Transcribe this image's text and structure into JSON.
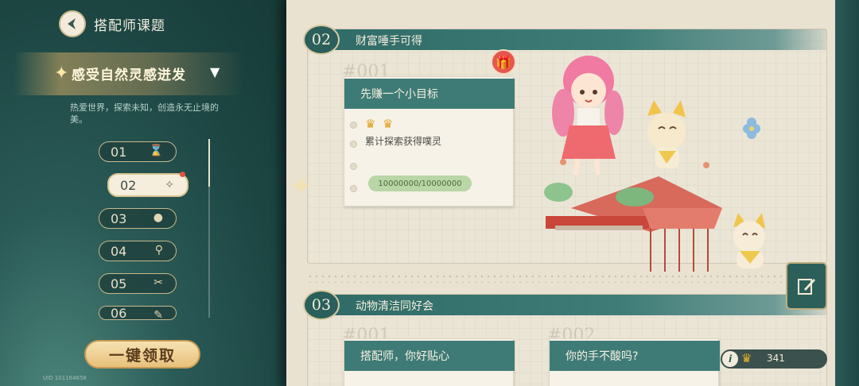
{
  "header": {
    "title": "搭配师课题"
  },
  "theme": {
    "title": "感受自然灵感迸发",
    "description": "热爱世界，探索未知，创造永无止境的美。"
  },
  "chapters": [
    {
      "label": "01",
      "icon": "hourglass-icon"
    },
    {
      "label": "02",
      "icon": "sparkle-icon"
    },
    {
      "label": "03",
      "icon": "macaron-icon"
    },
    {
      "label": "04",
      "icon": "magnifier-icon"
    },
    {
      "label": "05",
      "icon": "sewing-icon"
    },
    {
      "label": "06",
      "icon": "brush-icon"
    }
  ],
  "claim_button": "一键领取",
  "uid": "UID 101164658",
  "cards": [
    {
      "number": "02",
      "title": "财富唾手可得",
      "ghost": "#001",
      "task_title": "先赚一个小目标",
      "task_text": "累计探索获得噗灵",
      "progress": "10000000/10000000",
      "crowns": 2
    },
    {
      "number": "03",
      "title": "动物清洁同好会",
      "ghost1": "#001",
      "ghost2": "#002",
      "task1_title": "搭配师，你好贴心",
      "task2_title": "你的手不酸吗?"
    }
  ],
  "score": {
    "value": "341"
  }
}
